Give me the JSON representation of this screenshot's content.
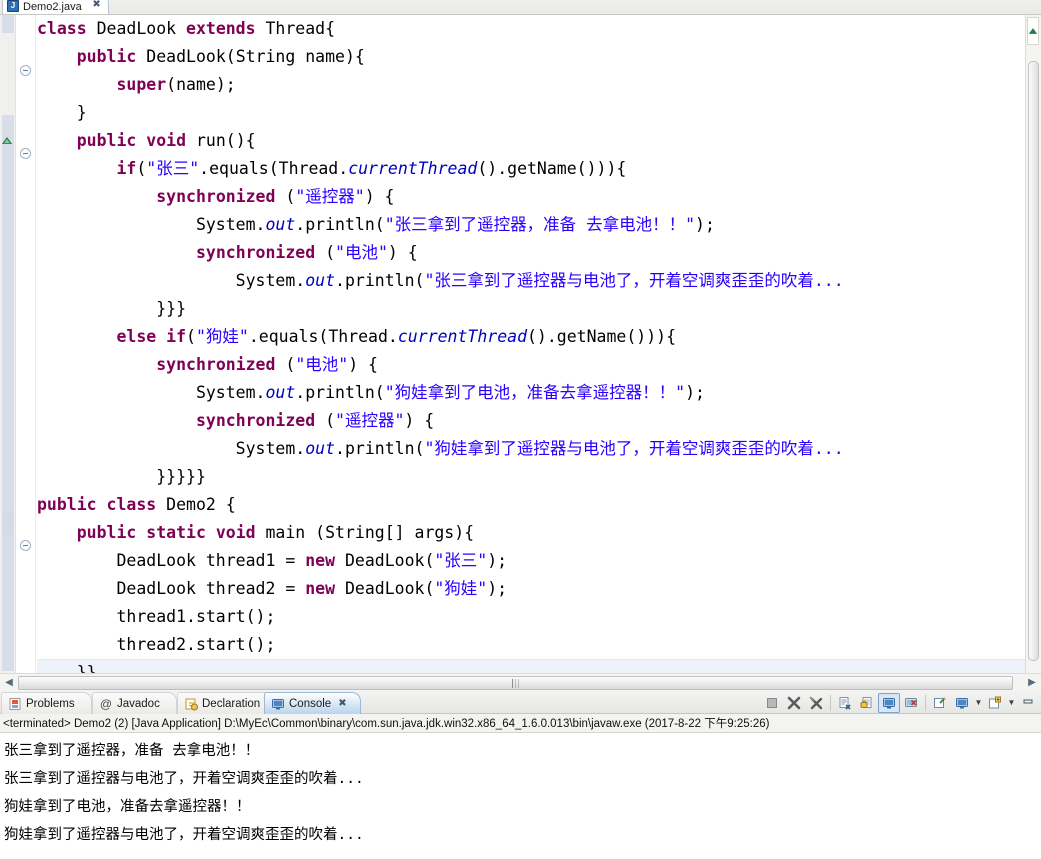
{
  "editor": {
    "tab": {
      "title": "Demo2.java",
      "icon": "java-file-icon",
      "icon_glyph": "J",
      "close_glyph": "✖"
    },
    "colors": {
      "keyword": "#7f0055",
      "string": "#2a00ff",
      "field": "#0000c0",
      "plain": "#000000",
      "background": "#ffffff"
    },
    "lines": [
      {
        "segments": [
          {
            "t": "class ",
            "c": "kw"
          },
          {
            "t": "DeadLook ",
            "c": "pln"
          },
          {
            "t": "extends ",
            "c": "kw"
          },
          {
            "t": "Thread{",
            "c": "pln"
          }
        ]
      },
      {
        "segments": [
          {
            "t": "    ",
            "c": "pln"
          },
          {
            "t": "public ",
            "c": "kw"
          },
          {
            "t": "DeadLook(String name){",
            "c": "pln"
          }
        ]
      },
      {
        "segments": [
          {
            "t": "        ",
            "c": "pln"
          },
          {
            "t": "super",
            "c": "kw"
          },
          {
            "t": "(name);",
            "c": "pln"
          }
        ]
      },
      {
        "segments": [
          {
            "t": "    }",
            "c": "pln"
          }
        ]
      },
      {
        "segments": [
          {
            "t": "    ",
            "c": "pln"
          },
          {
            "t": "public void ",
            "c": "kw"
          },
          {
            "t": "run(){",
            "c": "pln"
          }
        ]
      },
      {
        "segments": [
          {
            "t": "        ",
            "c": "pln"
          },
          {
            "t": "if",
            "c": "kw"
          },
          {
            "t": "(",
            "c": "pln"
          },
          {
            "t": "\"张三\"",
            "c": "str"
          },
          {
            "t": ".equals(Thread.",
            "c": "pln"
          },
          {
            "t": "currentThread",
            "c": "fld"
          },
          {
            "t": "().getName())){",
            "c": "pln"
          }
        ]
      },
      {
        "segments": [
          {
            "t": "            ",
            "c": "pln"
          },
          {
            "t": "synchronized",
            "c": "kw"
          },
          {
            "t": " (",
            "c": "pln"
          },
          {
            "t": "\"遥控器\"",
            "c": "str"
          },
          {
            "t": ") {",
            "c": "pln"
          }
        ]
      },
      {
        "segments": [
          {
            "t": "                System.",
            "c": "pln"
          },
          {
            "t": "out",
            "c": "fld"
          },
          {
            "t": ".println(",
            "c": "pln"
          },
          {
            "t": "\"张三拿到了遥控器，准备 去拿电池！！\"",
            "c": "str"
          },
          {
            "t": ");",
            "c": "pln"
          }
        ]
      },
      {
        "segments": [
          {
            "t": "                ",
            "c": "pln"
          },
          {
            "t": "synchronized",
            "c": "kw"
          },
          {
            "t": " (",
            "c": "pln"
          },
          {
            "t": "\"电池\"",
            "c": "str"
          },
          {
            "t": ") {",
            "c": "pln"
          }
        ]
      },
      {
        "segments": [
          {
            "t": "                    System.",
            "c": "pln"
          },
          {
            "t": "out",
            "c": "fld"
          },
          {
            "t": ".println(",
            "c": "pln"
          },
          {
            "t": "\"张三拿到了遥控器与电池了，开着空调爽歪歪的吹着...",
            "c": "str"
          }
        ]
      },
      {
        "segments": [
          {
            "t": "            }}}",
            "c": "pln"
          }
        ]
      },
      {
        "segments": [
          {
            "t": "        ",
            "c": "pln"
          },
          {
            "t": "else if",
            "c": "kw"
          },
          {
            "t": "(",
            "c": "pln"
          },
          {
            "t": "\"狗娃\"",
            "c": "str"
          },
          {
            "t": ".equals(Thread.",
            "c": "pln"
          },
          {
            "t": "currentThread",
            "c": "fld"
          },
          {
            "t": "().getName())){",
            "c": "pln"
          }
        ]
      },
      {
        "segments": [
          {
            "t": "            ",
            "c": "pln"
          },
          {
            "t": "synchronized",
            "c": "kw"
          },
          {
            "t": " (",
            "c": "pln"
          },
          {
            "t": "\"电池\"",
            "c": "str"
          },
          {
            "t": ") {",
            "c": "pln"
          }
        ]
      },
      {
        "segments": [
          {
            "t": "                System.",
            "c": "pln"
          },
          {
            "t": "out",
            "c": "fld"
          },
          {
            "t": ".println(",
            "c": "pln"
          },
          {
            "t": "\"狗娃拿到了电池，准备去拿遥控器！！\"",
            "c": "str"
          },
          {
            "t": ");",
            "c": "pln"
          }
        ]
      },
      {
        "segments": [
          {
            "t": "                ",
            "c": "pln"
          },
          {
            "t": "synchronized",
            "c": "kw"
          },
          {
            "t": " (",
            "c": "pln"
          },
          {
            "t": "\"遥控器\"",
            "c": "str"
          },
          {
            "t": ") {",
            "c": "pln"
          }
        ]
      },
      {
        "segments": [
          {
            "t": "                    System.",
            "c": "pln"
          },
          {
            "t": "out",
            "c": "fld"
          },
          {
            "t": ".println(",
            "c": "pln"
          },
          {
            "t": "\"狗娃拿到了遥控器与电池了，开着空调爽歪歪的吹着...",
            "c": "str"
          }
        ]
      },
      {
        "segments": [
          {
            "t": "            }}}}}",
            "c": "pln"
          }
        ]
      },
      {
        "segments": [
          {
            "t": "public class ",
            "c": "kw"
          },
          {
            "t": "Demo2 {",
            "c": "pln"
          }
        ]
      },
      {
        "segments": [
          {
            "t": "    ",
            "c": "pln"
          },
          {
            "t": "public static void ",
            "c": "kw"
          },
          {
            "t": "main (String[] args){",
            "c": "pln"
          }
        ]
      },
      {
        "segments": [
          {
            "t": "        DeadLook thread1 = ",
            "c": "pln"
          },
          {
            "t": "new ",
            "c": "kw"
          },
          {
            "t": "DeadLook(",
            "c": "pln"
          },
          {
            "t": "\"张三\"",
            "c": "str"
          },
          {
            "t": ");",
            "c": "pln"
          }
        ]
      },
      {
        "segments": [
          {
            "t": "        DeadLook thread2 = ",
            "c": "pln"
          },
          {
            "t": "new ",
            "c": "kw"
          },
          {
            "t": "DeadLook(",
            "c": "pln"
          },
          {
            "t": "\"狗娃\"",
            "c": "str"
          },
          {
            "t": ");",
            "c": "pln"
          }
        ]
      },
      {
        "segments": [
          {
            "t": "        thread1.start();",
            "c": "pln"
          }
        ]
      },
      {
        "segments": [
          {
            "t": "        thread2.start();",
            "c": "pln"
          }
        ]
      },
      {
        "segments": [
          {
            "t": "    }}",
            "c": "pln"
          }
        ]
      }
    ]
  },
  "hscroll": {
    "left_arrow": "◀",
    "right_arrow": "▶"
  },
  "bottom": {
    "tabs": [
      {
        "label": "Problems",
        "icon": "problems-icon",
        "active": false,
        "closable": false
      },
      {
        "label": "Javadoc",
        "icon": "javadoc-icon",
        "active": false,
        "closable": false
      },
      {
        "label": "Declaration",
        "icon": "declaration-icon",
        "active": false,
        "closable": false
      },
      {
        "label": "Console",
        "icon": "console-icon",
        "active": true,
        "closable": true
      }
    ],
    "close_glyph": "✖",
    "toolbar": [
      {
        "name": "terminate-button",
        "icon": "terminate-icon",
        "pressed": false
      },
      {
        "name": "remove-launch-button",
        "icon": "remove-launch-icon",
        "pressed": false
      },
      {
        "name": "remove-all-terminated-button",
        "icon": "remove-all-terminated-icon",
        "pressed": false
      },
      {
        "name": "clear-console-button",
        "icon": "clear-console-icon",
        "pressed": false
      },
      {
        "name": "scroll-lock-button",
        "icon": "scroll-lock-icon",
        "pressed": false
      },
      {
        "name": "show-console-on-output-button",
        "icon": "show-console-output-icon",
        "pressed": true
      },
      {
        "name": "show-console-on-error-button",
        "icon": "show-console-error-icon",
        "pressed": false
      },
      {
        "name": "pin-console-button",
        "icon": "pin-console-icon",
        "pressed": false
      },
      {
        "name": "display-selected-console-button",
        "icon": "display-console-icon",
        "pressed": false
      },
      {
        "name": "open-console-button",
        "icon": "open-console-icon",
        "pressed": false
      },
      {
        "name": "minimize-button",
        "icon": "minimize-icon",
        "pressed": false
      }
    ],
    "process_line": "<terminated> Demo2 (2) [Java Application] D:\\MyEc\\Common\\binary\\com.sun.java.jdk.win32.x86_64_1.6.0.013\\bin\\javaw.exe (2017-8-22 下午9:25:26)",
    "output": [
      "张三拿到了遥控器，准备 去拿电池！！",
      "张三拿到了遥控器与电池了，开着空调爽歪歪的吹着...",
      "狗娃拿到了电池，准备去拿遥控器！！",
      "狗娃拿到了遥控器与电池了，开着空调爽歪歪的吹着..."
    ]
  }
}
